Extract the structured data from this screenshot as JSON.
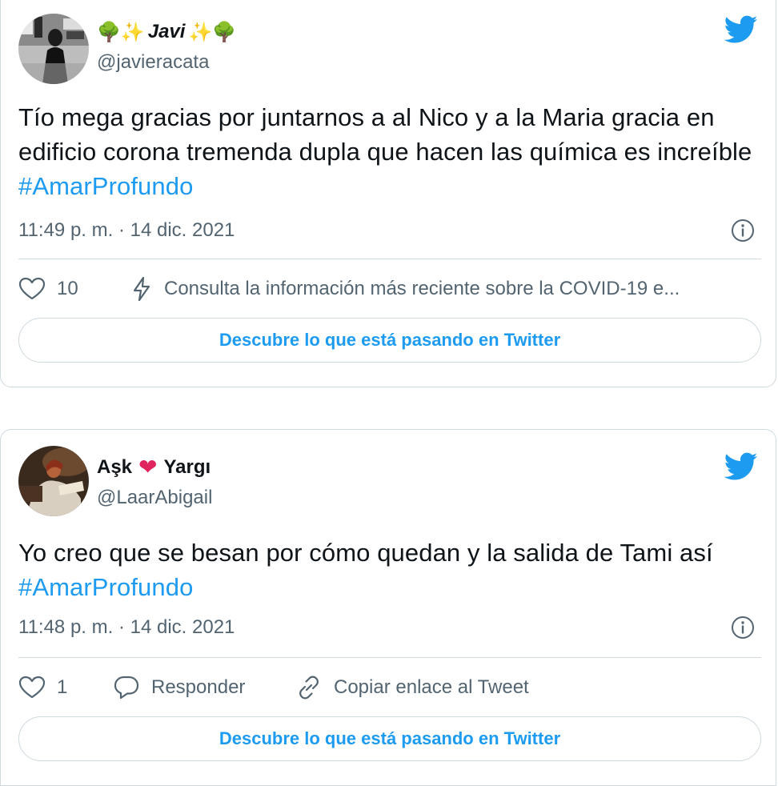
{
  "colors": {
    "accent": "#1d9bf0",
    "secondary_text": "#536471",
    "border": "#cfd9de",
    "heart": "#e0245e"
  },
  "tweets": [
    {
      "display_name_emoji_left": "🌳✨",
      "display_name": "Javi",
      "display_name_emoji_right": "✨🌳",
      "handle": "@javieracata",
      "text": "Tío mega gracias por juntarnos a al Nico y a la Maria gracia en edificio corona tremenda dupla que hacen las química es increíble ",
      "hashtag": "#AmarProfundo",
      "timestamp": "11:49 p. m. · 14 dic. 2021",
      "likes": "10",
      "covid_link": "Consulta la información más reciente sobre la COVID-19 e...",
      "discover_label": "Descubre lo que está pasando en Twitter",
      "icons": {
        "brand": "twitter-bird-icon",
        "info": "info-icon",
        "like": "heart-icon",
        "covid": "lightning-icon"
      }
    },
    {
      "display_name_left": "Aşk",
      "display_name_heart": "❤",
      "display_name_right": "Yargı",
      "handle": "@LaarAbigail",
      "text": "Yo creo que se besan por cómo quedan y la salida de Tami así ",
      "hashtag": "#AmarProfundo",
      "timestamp": "11:48 p. m. · 14 dic. 2021",
      "likes": "1",
      "reply_label": "Responder",
      "copy_link_label": "Copiar enlace al Tweet",
      "discover_label": "Descubre lo que está pasando en Twitter",
      "icons": {
        "brand": "twitter-bird-icon",
        "info": "info-icon",
        "like": "heart-icon",
        "reply": "reply-icon",
        "link": "link-icon"
      }
    }
  ]
}
